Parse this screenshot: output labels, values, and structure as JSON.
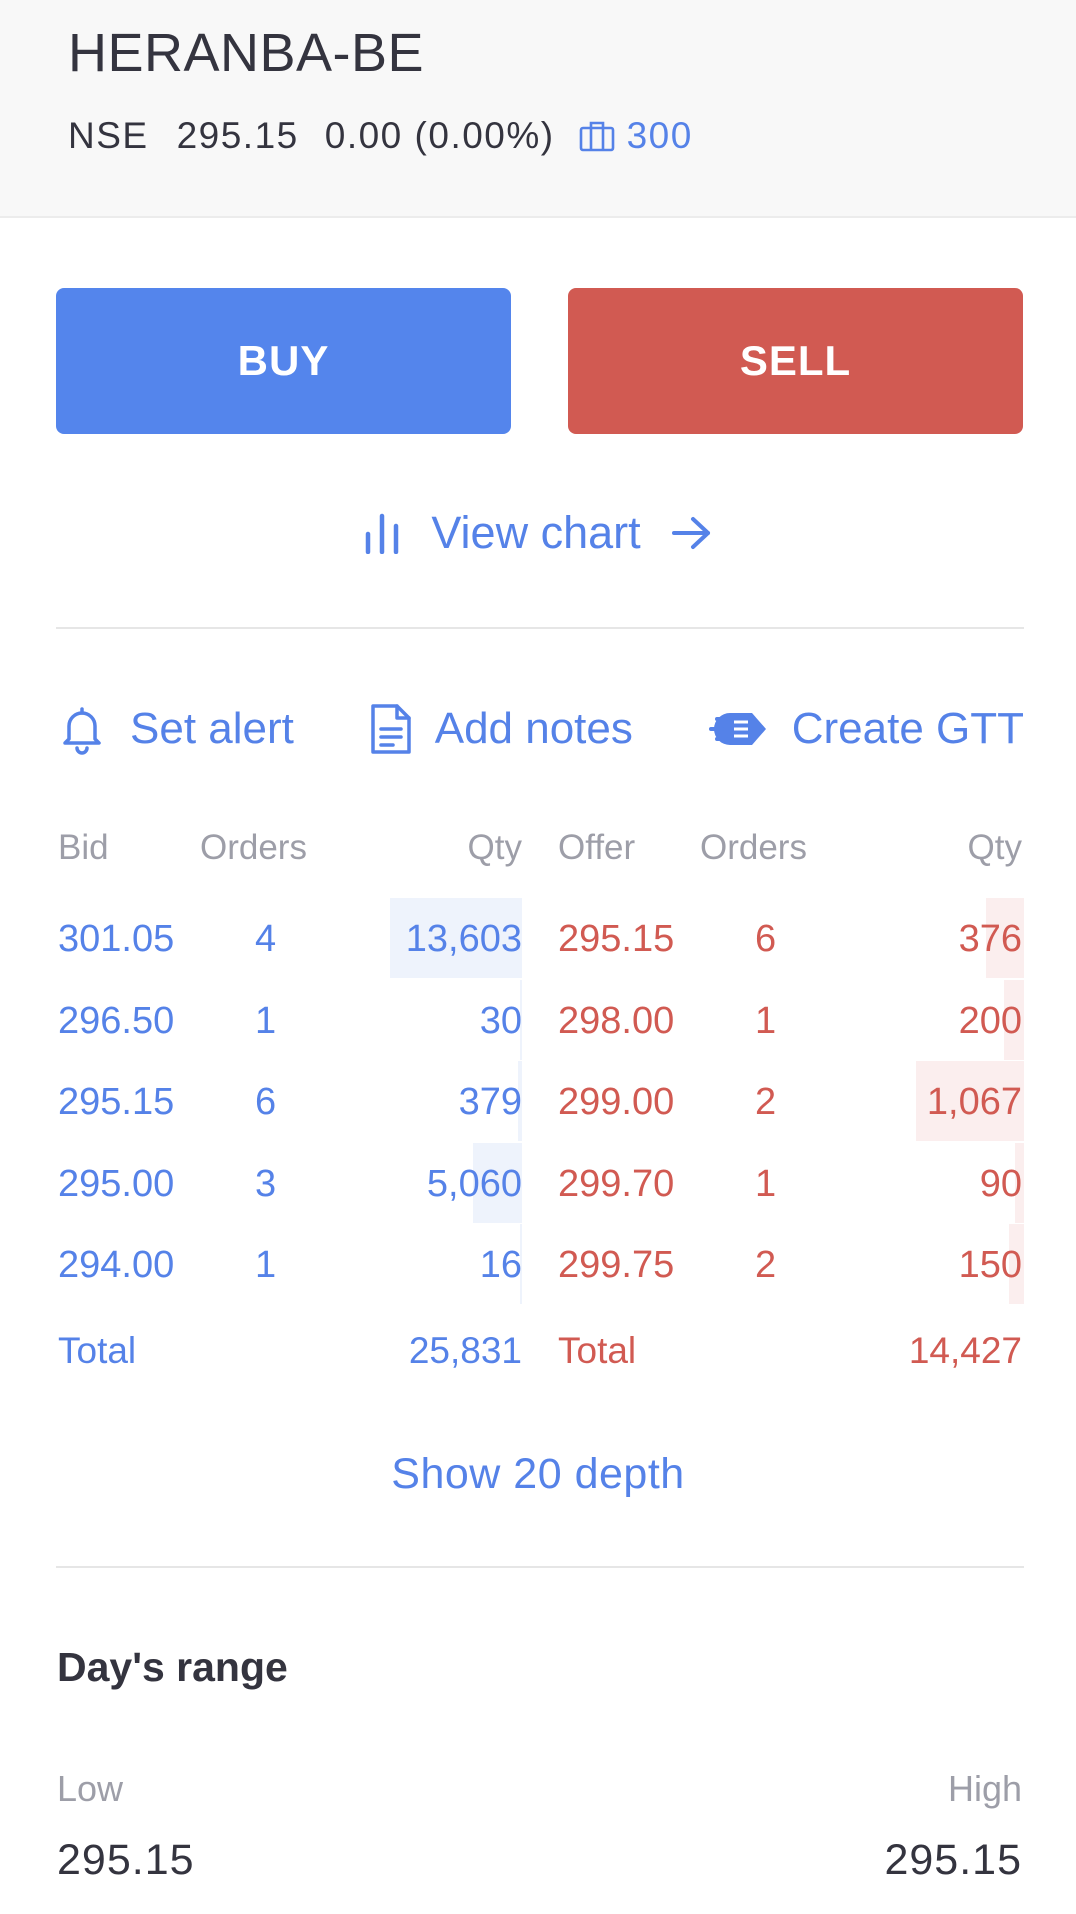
{
  "header": {
    "symbol": "HERANBA-BE",
    "exchange": "NSE",
    "ltp": "295.15",
    "change": "0.00 (0.00%)",
    "holdings_qty": "300",
    "holdings_icon": "briefcase-icon"
  },
  "buttons": {
    "buy": "BUY",
    "sell": "SELL"
  },
  "view_chart": {
    "label": "View chart"
  },
  "actions": {
    "set_alert": "Set alert",
    "add_notes": "Add notes",
    "create_gtt": "Create GTT"
  },
  "depth": {
    "headers": {
      "bid": "Bid",
      "bid_orders": "Orders",
      "bid_qty": "Qty",
      "offer": "Offer",
      "offer_orders": "Orders",
      "offer_qty": "Qty"
    },
    "bids": [
      {
        "price": "301.05",
        "orders": "4",
        "qty": "13,603",
        "qty_value": 13603
      },
      {
        "price": "296.50",
        "orders": "1",
        "qty": "30",
        "qty_value": 30
      },
      {
        "price": "295.15",
        "orders": "6",
        "qty": "379",
        "qty_value": 379
      },
      {
        "price": "295.00",
        "orders": "3",
        "qty": "5,060",
        "qty_value": 5060
      },
      {
        "price": "294.00",
        "orders": "1",
        "qty": "16",
        "qty_value": 16
      }
    ],
    "offers": [
      {
        "price": "295.15",
        "orders": "6",
        "qty": "376",
        "qty_value": 376
      },
      {
        "price": "298.00",
        "orders": "1",
        "qty": "200",
        "qty_value": 200
      },
      {
        "price": "299.00",
        "orders": "2",
        "qty": "1,067",
        "qty_value": 1067
      },
      {
        "price": "299.70",
        "orders": "1",
        "qty": "90",
        "qty_value": 90
      },
      {
        "price": "299.75",
        "orders": "2",
        "qty": "150",
        "qty_value": 150
      }
    ],
    "total_label_bid": "Total",
    "total_bid": "25,831",
    "total_label_offer": "Total",
    "total_offer": "14,427",
    "show_depth": "Show 20 depth"
  },
  "days_range": {
    "title": "Day's range",
    "low_label": "Low",
    "high_label": "High",
    "low": "295.15",
    "high": "295.15"
  },
  "colors": {
    "accent": "#5485ec",
    "sell": "#d15a52",
    "bid_text": "#5582e8",
    "ask_text": "#d15a52"
  }
}
